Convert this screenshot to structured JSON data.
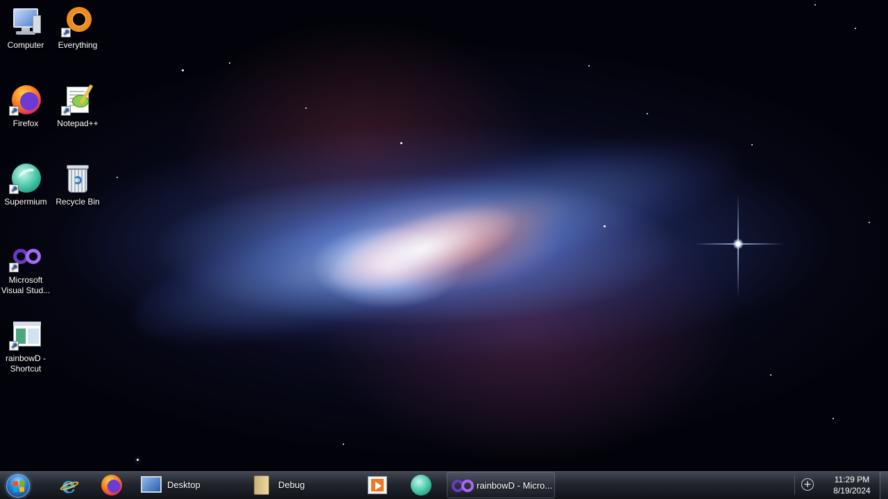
{
  "desktop": {
    "icons": [
      {
        "label": "Computer",
        "icon": "computer-icon"
      },
      {
        "label": "Everything",
        "icon": "everything-icon"
      },
      {
        "label": "Firefox",
        "icon": "firefox-icon"
      },
      {
        "label": "Notepad++",
        "icon": "notepad-plus-plus-icon"
      },
      {
        "label": "Supermium",
        "icon": "supermium-icon"
      },
      {
        "label": "Recycle Bin",
        "icon": "recycle-bin-icon"
      },
      {
        "label_line1": "Microsoft",
        "label_line2": "Visual Stud...",
        "icon": "visual-studio-icon"
      },
      {
        "label_line1": "rainbowD -",
        "label_line2": "Shortcut",
        "icon": "rainbowd-icon"
      }
    ]
  },
  "taskbar": {
    "start_icon": "windows-start-orb-icon",
    "pinned": [
      {
        "icon": "internet-explorer-icon"
      },
      {
        "icon": "firefox-icon"
      }
    ],
    "windows": [
      {
        "label": "Desktop",
        "icon": "desktop-folder-icon"
      },
      {
        "label": "Debug",
        "icon": "folder-icon"
      },
      {
        "icon": "media-player-icon"
      },
      {
        "icon": "supermium-icon"
      },
      {
        "label": "rainbowD - Micro...",
        "icon": "visual-studio-icon"
      }
    ],
    "tray_icon": "tray-add-icon",
    "clock": {
      "time": "11:29 PM",
      "date": "8/19/2024"
    }
  },
  "colors": {
    "taskbar_top": "#464c58",
    "taskbar_bottom": "#12141a",
    "desktop_text": "#ffffff"
  }
}
